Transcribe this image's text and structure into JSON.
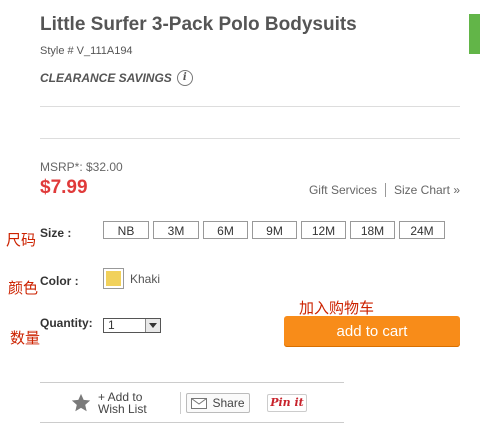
{
  "product": {
    "title": "Little Surfer 3-Pack Polo Bodysuits",
    "style": "Style # V_111A194",
    "clearance": "CLEARANCE SAVINGS",
    "info": "i"
  },
  "price": {
    "msrp": "MSRP*: $32.00",
    "current": "$7.99"
  },
  "links": {
    "gift": "Gift Services",
    "size_chart": "Size Chart »"
  },
  "annotations": {
    "size": "尺码",
    "color": "颜色",
    "quantity": "数量",
    "add_to_cart": "加入购物车"
  },
  "size": {
    "label": "Size :",
    "options": [
      "NB",
      "3M",
      "6M",
      "9M",
      "12M",
      "18M",
      "24M"
    ]
  },
  "color": {
    "label": "Color :",
    "name": "Khaki",
    "swatch": "#f1d15b"
  },
  "quantity": {
    "label": "Quantity:",
    "value": "1"
  },
  "cart": {
    "label": "add to cart",
    "color": "#f88c19"
  },
  "bottom": {
    "wishlist_line1": "+ Add to",
    "wishlist_line2": "Wish List",
    "share": "Share",
    "pinit": "Pin it"
  }
}
